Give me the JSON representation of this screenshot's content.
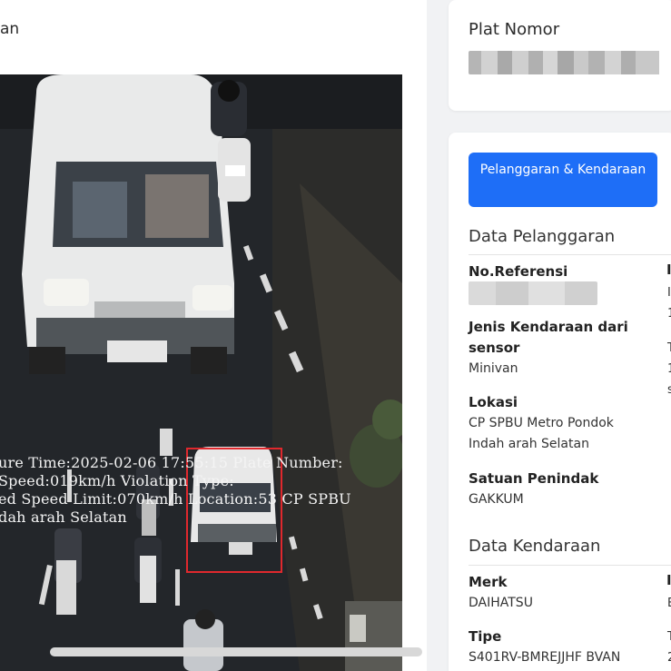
{
  "left_panel": {
    "title_fragment": "an",
    "camera_overlay": {
      "line1": "ure Time:2025-02-06 17:55:15 Plate Number:",
      "line2": "Speed:019km/h Violation Type:",
      "line3": "ed Speed Limit:070km/h Location:53 CP SPBU",
      "line4": "dah arah Selatan"
    }
  },
  "plate": {
    "label": "Plat Nomor"
  },
  "details": {
    "tab_label": "Pelanggaran & Kendaraan",
    "violation_section": {
      "title": "Data Pelanggaran",
      "ref_label": "No.Referensi",
      "sensor_label": "Jenis Kendaraan dari sensor",
      "sensor_value": "Minivan",
      "location_label": "Lokasi",
      "location_value": "CP SPBU Metro Pondok Indah arah Selatan",
      "unit_label": "Satuan Penindak",
      "unit_value": "GAKKUM"
    },
    "vehicle_section": {
      "title": "Data Kendaraan",
      "brand_label": "Merk",
      "brand_value": "DAIHATSU",
      "type_label": "Tipe",
      "type_value": "S401RV-BMREJJHF BVAN"
    },
    "edge_glyphs": {
      "col2_a": "I",
      "col2_b": "I",
      "col2_c": "1",
      "col2_d": "T",
      "col2_e": "1",
      "col2_f": "s",
      "col2_g": "I",
      "col2_h": "E",
      "col2_i": "T",
      "col2_j": "2"
    }
  },
  "colors": {
    "primary_button": "#1e6ef7",
    "violation_box": "#e0282d"
  }
}
